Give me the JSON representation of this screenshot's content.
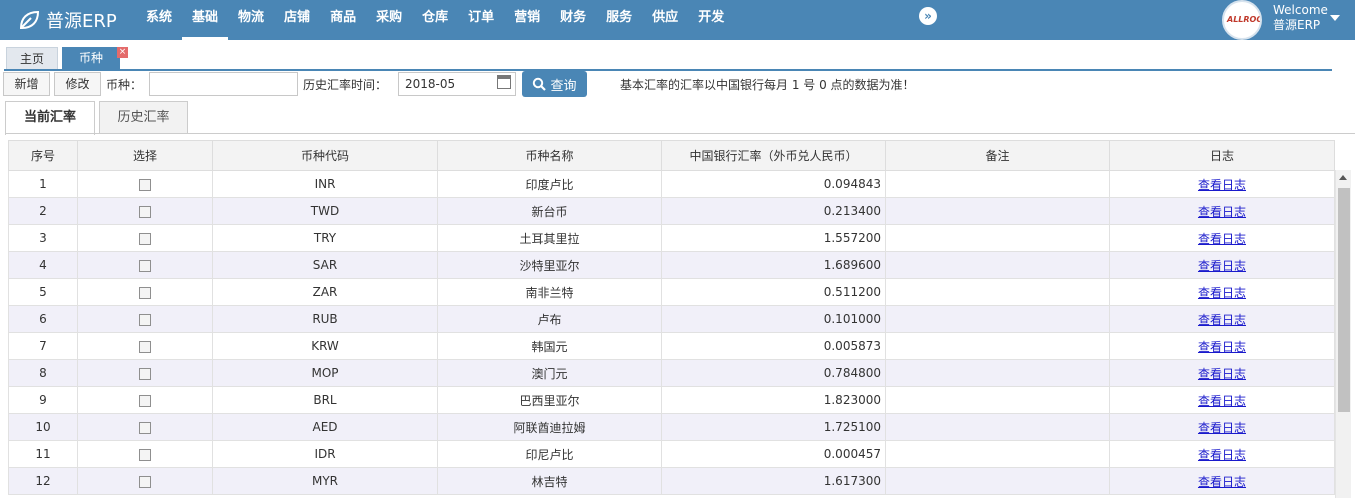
{
  "header": {
    "app_name": "普源ERP",
    "nav": [
      "系统",
      "基础",
      "物流",
      "店铺",
      "商品",
      "采购",
      "仓库",
      "订单",
      "营销",
      "财务",
      "服务",
      "供应",
      "开发"
    ],
    "active_nav": "基础",
    "avatar_text": "ALLROOT",
    "welcome": "Welcome",
    "user": "普源ERP",
    "brand_color": "#4a86b5"
  },
  "page_tabs": {
    "home": "主页",
    "current": "币种",
    "close": "×"
  },
  "toolbar": {
    "add": "新增",
    "edit": "修改",
    "currency_label": "币种：",
    "currency_value": "",
    "history_label": "历史汇率时间：",
    "history_value": "2018-05",
    "query": "查询",
    "notice": "基本汇率的汇率以中国银行每月 1 号 0 点的数据为准！"
  },
  "sub_tabs": {
    "current": "当前汇率",
    "history": "历史汇率"
  },
  "table": {
    "headers": [
      "序号",
      "选择",
      "币种代码",
      "币种名称",
      "中国银行汇率（外币兑人民币）",
      "备注",
      "日志"
    ],
    "link_text": "查看日志",
    "rows": [
      {
        "no": "1",
        "code": "INR",
        "name": "印度卢比",
        "rate": "0.094843",
        "note": ""
      },
      {
        "no": "2",
        "code": "TWD",
        "name": "新台币",
        "rate": "0.213400",
        "note": ""
      },
      {
        "no": "3",
        "code": "TRY",
        "name": "土耳其里拉",
        "rate": "1.557200",
        "note": ""
      },
      {
        "no": "4",
        "code": "SAR",
        "name": "沙特里亚尔",
        "rate": "1.689600",
        "note": ""
      },
      {
        "no": "5",
        "code": "ZAR",
        "name": "南非兰特",
        "rate": "0.511200",
        "note": ""
      },
      {
        "no": "6",
        "code": "RUB",
        "name": "卢布",
        "rate": "0.101000",
        "note": ""
      },
      {
        "no": "7",
        "code": "KRW",
        "name": "韩国元",
        "rate": "0.005873",
        "note": ""
      },
      {
        "no": "8",
        "code": "MOP",
        "name": "澳门元",
        "rate": "0.784800",
        "note": ""
      },
      {
        "no": "9",
        "code": "BRL",
        "name": "巴西里亚尔",
        "rate": "1.823000",
        "note": ""
      },
      {
        "no": "10",
        "code": "AED",
        "name": "阿联酋迪拉姆",
        "rate": "1.725100",
        "note": ""
      },
      {
        "no": "11",
        "code": "IDR",
        "name": "印尼卢比",
        "rate": "0.000457",
        "note": ""
      },
      {
        "no": "12",
        "code": "MYR",
        "name": "林吉特",
        "rate": "1.617300",
        "note": ""
      }
    ]
  }
}
